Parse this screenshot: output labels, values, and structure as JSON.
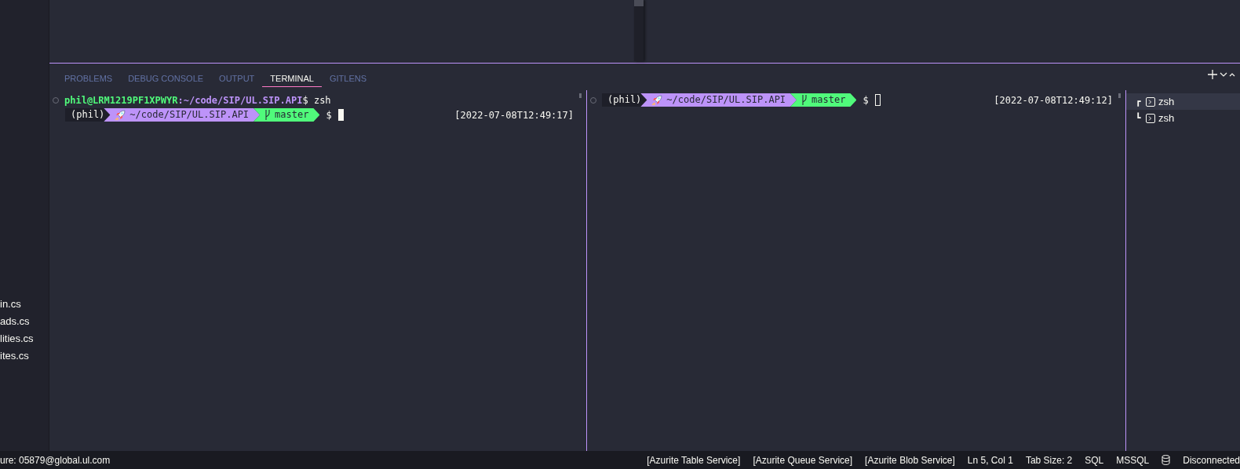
{
  "sidebar": {
    "files": [
      "in.cs",
      "ads.cs",
      "lities.cs",
      "ites.cs"
    ]
  },
  "panel": {
    "tabs": [
      {
        "label": "PROBLEMS",
        "selected": false
      },
      {
        "label": "DEBUG CONSOLE",
        "selected": false
      },
      {
        "label": "OUTPUT",
        "selected": false
      },
      {
        "label": "TERMINAL",
        "selected": true
      },
      {
        "label": "GITLENS",
        "selected": false
      }
    ]
  },
  "terminals": [
    {
      "focused": true,
      "lines": [
        {
          "kind": "command",
          "user": "phil@LRM1219PF1XPWYR",
          "path": ":~/code/SIP/UL.SIP.API",
          "command": "$ zsh"
        },
        {
          "kind": "prompt",
          "env": "(phil)",
          "path": "~/code/SIP/UL.SIP.API",
          "branch": "master",
          "symbol": "$",
          "time": "[2022-07-08T12:49:17]"
        }
      ]
    },
    {
      "focused": false,
      "lines": [
        {
          "kind": "prompt",
          "env": "(phil)",
          "path": "~/code/SIP/UL.SIP.API",
          "branch": "master",
          "symbol": "$",
          "time": "[2022-07-08T12:49:12]"
        }
      ]
    }
  ],
  "terminal_list": [
    {
      "tree": "┏",
      "label": "zsh",
      "selected": true
    },
    {
      "tree": "┗",
      "label": "zsh",
      "selected": false
    }
  ],
  "status_bar": {
    "account": "ure: 05879@global.ul.com",
    "items": [
      "[Azurite Table Service]",
      "[Azurite Queue Service]",
      "[Azurite Blob Service]",
      "Ln 5, Col 1",
      "Tab Size: 2",
      "SQL",
      "MSSQL"
    ],
    "connection": "Disconnected"
  }
}
